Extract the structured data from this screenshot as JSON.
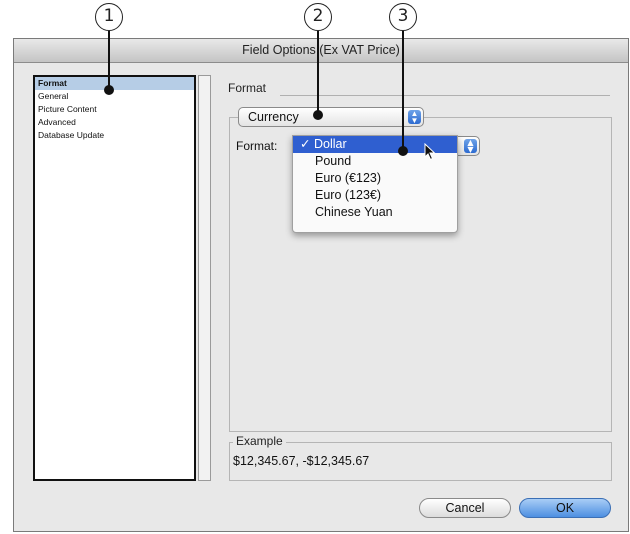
{
  "callouts": [
    "1",
    "2",
    "3"
  ],
  "window": {
    "title": "Field Options (Ex VAT Price)"
  },
  "sidebar": {
    "items": [
      {
        "label": "Format"
      },
      {
        "label": "General"
      },
      {
        "label": "Picture Content"
      },
      {
        "label": "Advanced"
      },
      {
        "label": "Database Update"
      }
    ],
    "selected_index": 0
  },
  "panel": {
    "title": "Format",
    "type_popup": {
      "value": "Currency"
    },
    "format_label": "Format:",
    "format_menu": {
      "options": [
        "Dollar",
        "Pound",
        "Euro (€123)",
        "Euro (123€)",
        "Chinese Yuan"
      ],
      "selected": "Dollar",
      "check": "✓"
    },
    "example": {
      "label": "Example",
      "value": "$12,345.67, -$12,345.67"
    }
  },
  "buttons": {
    "cancel": "Cancel",
    "ok": "OK"
  },
  "colors": {
    "selection": "#2f5fd0",
    "list_selection": "#b6cde6",
    "ok_button": "#4d8fe1"
  },
  "icons": {
    "popup_arrows": "up-down-arrows-icon",
    "cursor": "mouse-pointer-icon"
  }
}
